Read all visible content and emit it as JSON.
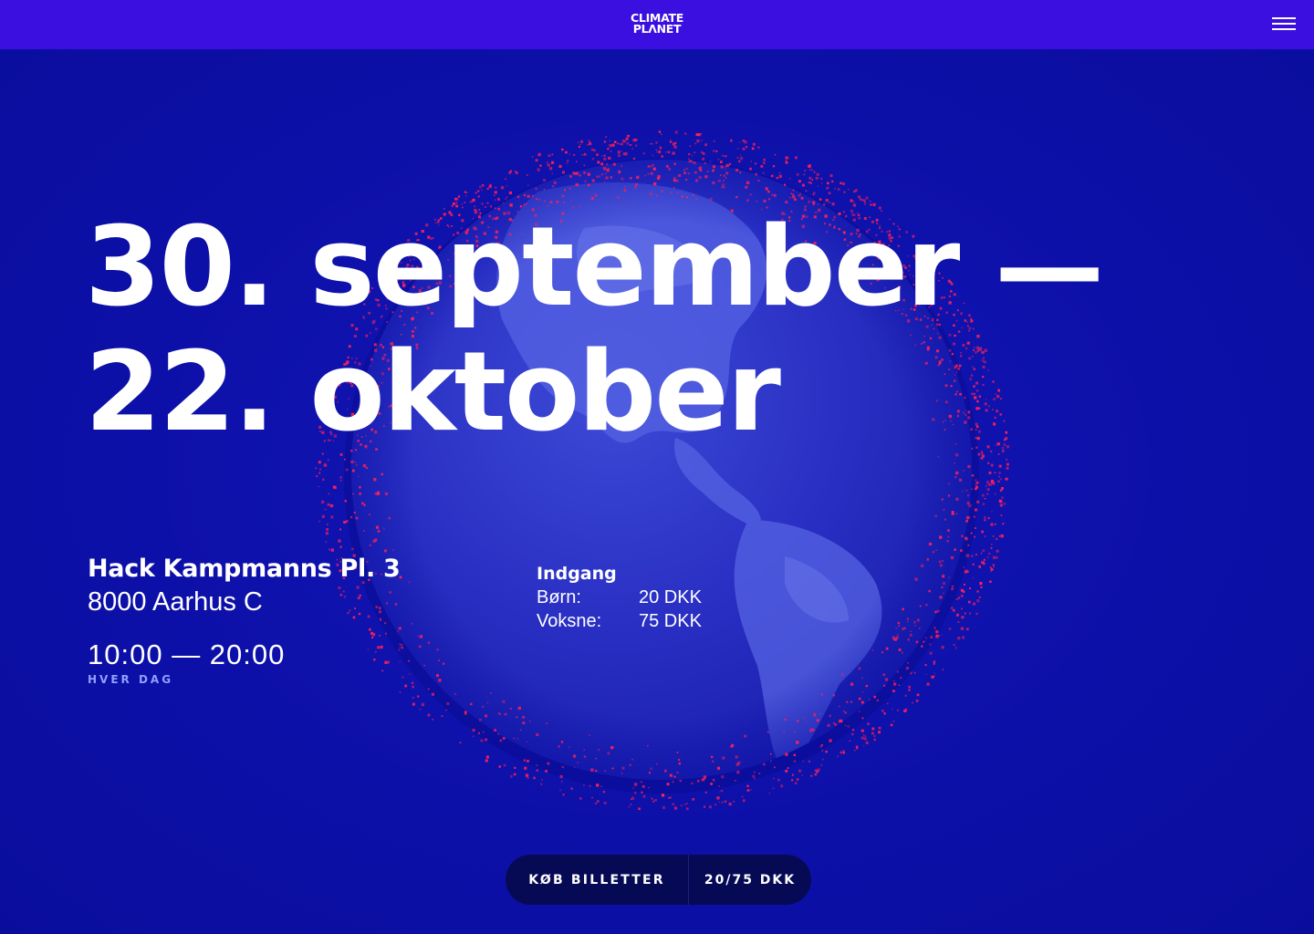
{
  "header": {
    "logo_line1": "CLIMATE",
    "logo_line2": "PLΛNET",
    "menu_icon": "hamburger-menu-icon"
  },
  "hero": {
    "line1": "30. september —",
    "line2": "22. oktober",
    "background_image": "globe-with-red-particles"
  },
  "location": {
    "street": "Hack Kampmanns Pl. 3",
    "city": "8000 Aarhus C"
  },
  "hours": {
    "time": "10:00 — 20:00",
    "days": "HVER DAG"
  },
  "admission": {
    "title": "Indgang",
    "rows": [
      {
        "label": "Børn:",
        "value": "20 DKK"
      },
      {
        "label": "Voksne:",
        "value": "75 DKK"
      }
    ]
  },
  "cta": {
    "buy_label": "KØB BILLETTER",
    "price_label": "20/75 DKK"
  },
  "colors": {
    "topbar": "#3a0fe0",
    "background": "#0c0fa6",
    "particles": "#ff1f5a",
    "cta_background": "#060a55",
    "muted_text": "#8fa0ff"
  }
}
